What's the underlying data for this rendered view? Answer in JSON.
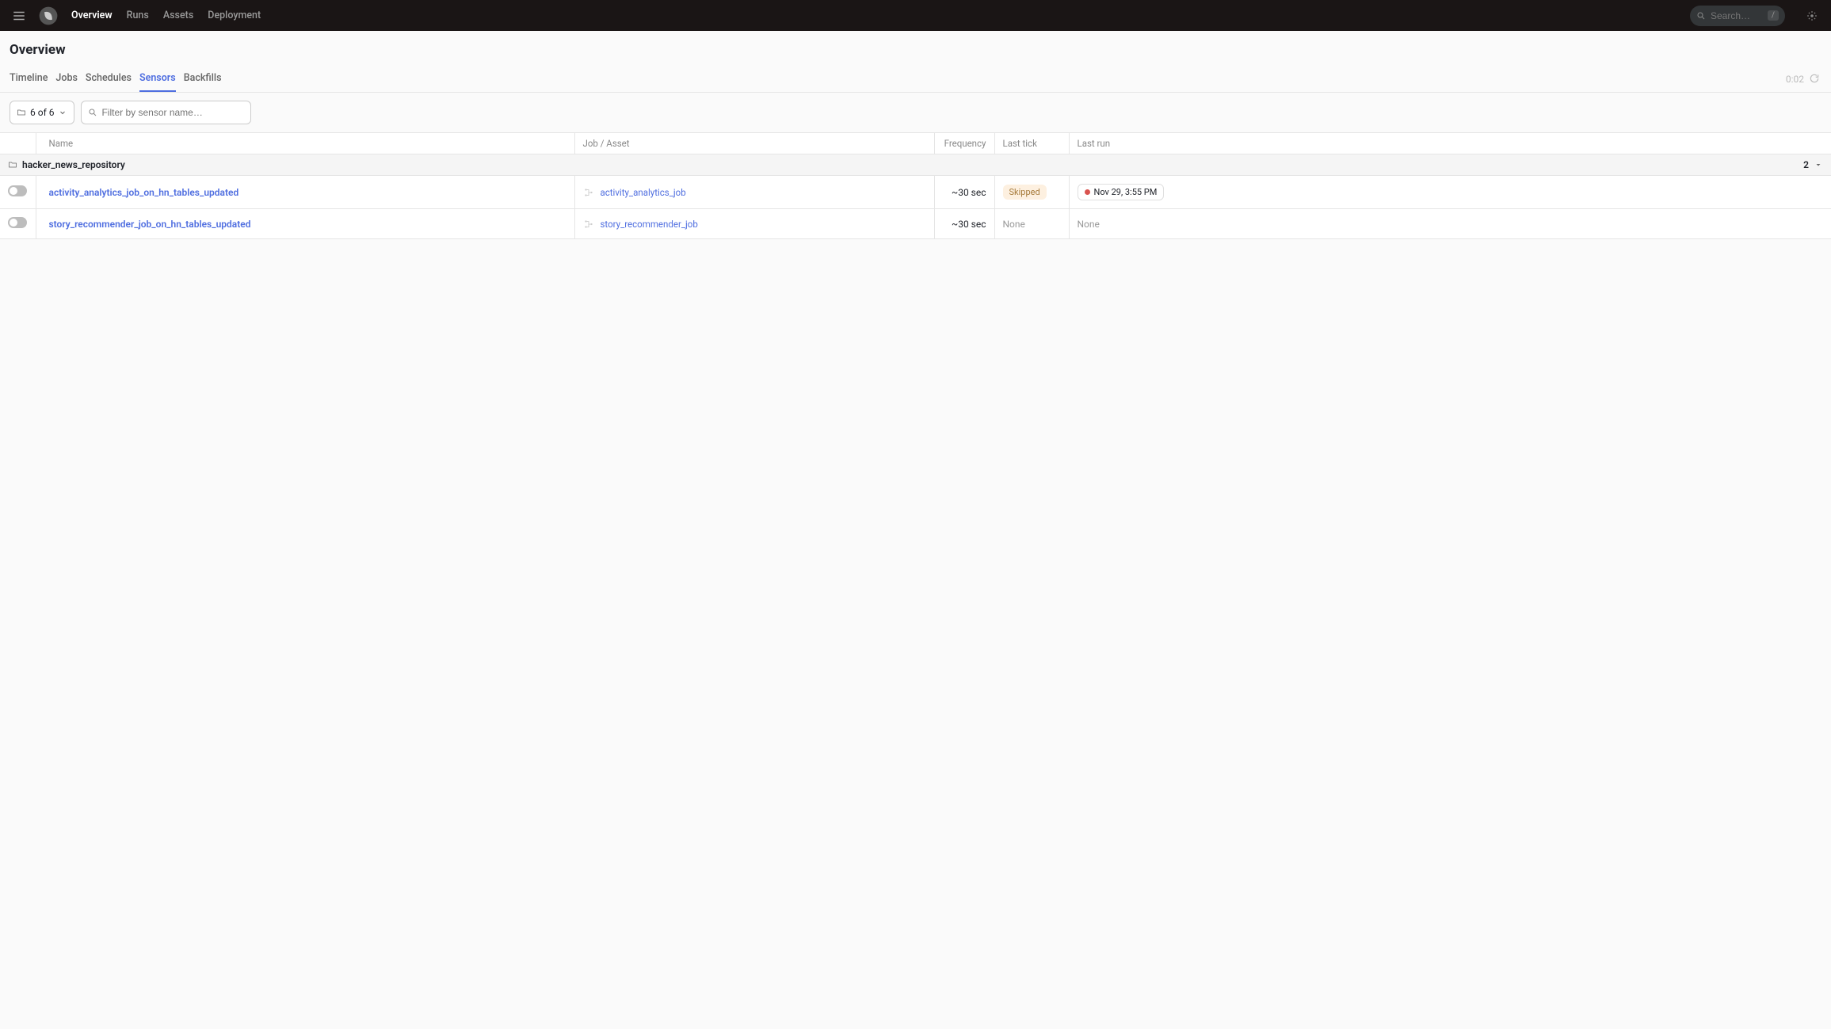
{
  "nav": {
    "links": [
      "Overview",
      "Runs",
      "Assets",
      "Deployment"
    ],
    "active": "Overview",
    "search_placeholder": "Search…",
    "search_hotkey": "/"
  },
  "page_title": "Overview",
  "tabs": {
    "items": [
      "Timeline",
      "Jobs",
      "Schedules",
      "Sensors",
      "Backfills"
    ],
    "active": "Sensors",
    "timer": "0:02"
  },
  "filters": {
    "repo_select": "6 of 6",
    "filter_placeholder": "Filter by sensor name…"
  },
  "columns": {
    "name": "Name",
    "job": "Job / Asset",
    "frequency": "Frequency",
    "last_tick": "Last tick",
    "last_run": "Last run"
  },
  "repo": {
    "name": "hacker_news_repository",
    "count": "2"
  },
  "rows": [
    {
      "sensor": "activity_analytics_job_on_hn_tables_updated",
      "job": "activity_analytics_job",
      "frequency": "~30 sec",
      "last_tick": "Skipped",
      "last_tick_type": "skipped",
      "last_run": "Nov 29, 3:55 PM",
      "last_run_type": "failed"
    },
    {
      "sensor": "story_recommender_job_on_hn_tables_updated",
      "job": "story_recommender_job",
      "frequency": "~30 sec",
      "last_tick": "None",
      "last_tick_type": "none",
      "last_run": "None",
      "last_run_type": "none"
    }
  ]
}
